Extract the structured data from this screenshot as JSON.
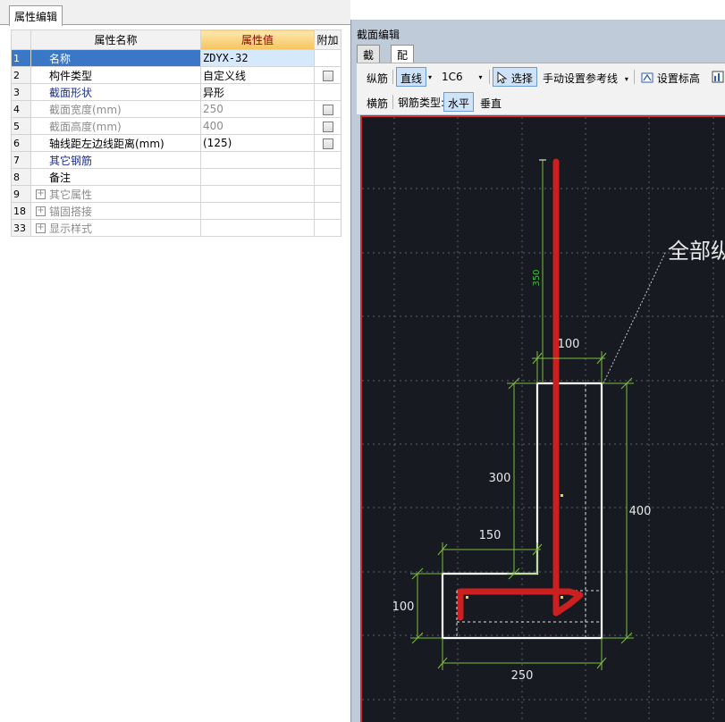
{
  "prop_editor": {
    "tab_label": "属性编辑",
    "headers": {
      "name": "属性名称",
      "value": "属性值",
      "extra": "附加"
    },
    "rows": [
      {
        "num": "1",
        "name": "名称",
        "value": "ZDYX-32",
        "style": "blue",
        "has_checkbox": false,
        "selected": true
      },
      {
        "num": "2",
        "name": "构件类型",
        "value": "自定义线",
        "style": "normal",
        "has_checkbox": true
      },
      {
        "num": "3",
        "name": "截面形状",
        "value": "异形",
        "style": "blue",
        "has_checkbox": false
      },
      {
        "num": "4",
        "name": "截面宽度(mm)",
        "value": "250",
        "style": "gray",
        "has_checkbox": true
      },
      {
        "num": "5",
        "name": "截面高度(mm)",
        "value": "400",
        "style": "gray",
        "has_checkbox": true
      },
      {
        "num": "6",
        "name": "轴线距左边线距离(mm)",
        "value": "(125)",
        "style": "normal",
        "has_checkbox": true
      },
      {
        "num": "7",
        "name": "其它钢筋",
        "value": "",
        "style": "blue",
        "has_checkbox": false
      },
      {
        "num": "8",
        "name": "备注",
        "value": "",
        "style": "normal",
        "has_checkbox": false
      },
      {
        "num": "9",
        "name": "其它属性",
        "value": "",
        "style": "gray",
        "expander": "+",
        "has_checkbox": false
      },
      {
        "num": "18",
        "name": "锚固搭接",
        "value": "",
        "style": "gray",
        "expander": "+",
        "has_checkbox": false
      },
      {
        "num": "33",
        "name": "显示样式",
        "value": "",
        "style": "gray",
        "expander": "+",
        "has_checkbox": false
      }
    ]
  },
  "section_editor": {
    "title": "截面编辑",
    "tabs": [
      {
        "label": "截面",
        "active": false
      },
      {
        "label": "配筋",
        "active": true
      }
    ],
    "toolbar1": {
      "longitudinal": "纵筋",
      "line_mode": "直线",
      "rebar_spec": "1C6",
      "select": "选择",
      "ref_line": "手动设置参考线",
      "set_elevation": "设置标高"
    },
    "toolbar2": {
      "stirrup": "横筋",
      "rebar_type_label": "钢筋类型:",
      "horizontal": "水平",
      "vertical": "垂直"
    },
    "canvas": {
      "callout_text": "全部纵",
      "dimensions": {
        "top_length": "350",
        "top_width": "100",
        "upper_height": "300",
        "total_height": "400",
        "flange_length": "150",
        "flange_height": "100",
        "total_width": "250"
      },
      "colors": {
        "background": "#171a21",
        "outline": "#ffffff",
        "rebar": "#cc1f1f",
        "dimension": "#7fbf3f",
        "grid": "#5a6070"
      }
    }
  }
}
